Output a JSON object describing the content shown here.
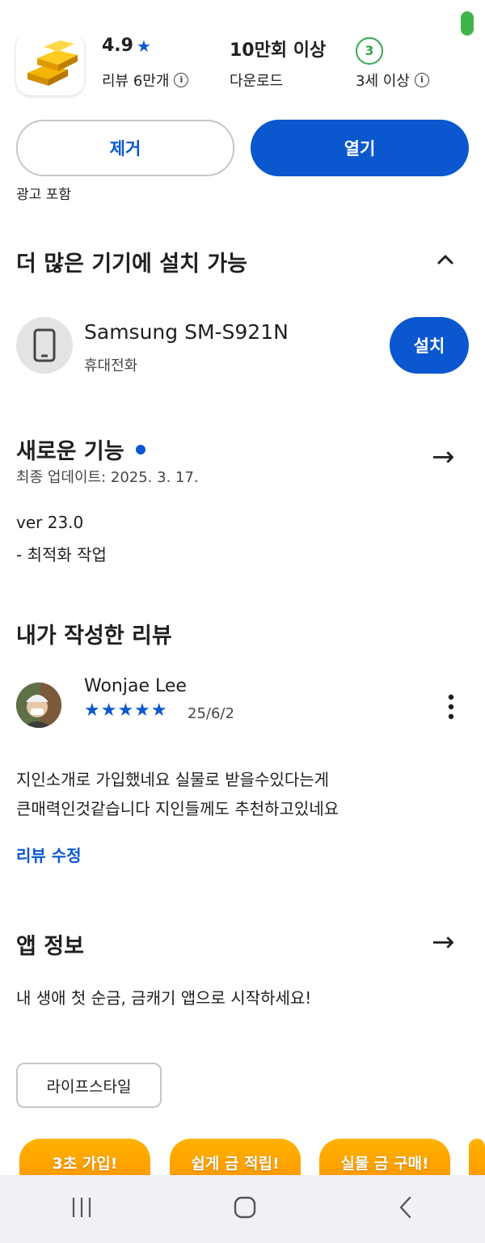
{
  "header": {
    "rating": "4.9",
    "reviews_label": "리뷰 6만개",
    "downloads_value": "10만회 이상",
    "downloads_label": "다운로드",
    "age_badge": "3",
    "age_label": "3세 이상"
  },
  "actions": {
    "uninstall_label": "제거",
    "open_label": "열기",
    "ads_note": "광고 포함"
  },
  "devices": {
    "title": "더 많은 기기에 설치 가능",
    "device_name": "Samsung SM-S921N",
    "device_type": "휴대전화",
    "install_label": "설치"
  },
  "whats_new": {
    "title": "새로운 기능",
    "updated": "최종 업데이트: 2025. 3. 17.",
    "version": "ver 23.0",
    "note": "- 최적화 작업"
  },
  "my_review": {
    "title": "내가 작성한 리뷰",
    "author": "Wonjae Lee",
    "stars": "★★★★★",
    "rating": 5,
    "date": "25/6/2",
    "line1": "지인소개로 가입했네요 실물로 받을수있다는게",
    "line2": "큰매력인것같습니다 지인들께도 추천하고있네요",
    "edit_label": "리뷰 수정"
  },
  "app_info": {
    "title": "앱 정보",
    "description": "내 생애 첫 순금, 금캐기 앱으로 시작하세요!",
    "category_chip": "라이프스타일"
  },
  "promos": [
    "3초 가입!",
    "쉽게 금 적립!",
    "실물 금 구매!"
  ],
  "colors": {
    "accent": "#0b57d0",
    "age_green": "#34a853",
    "promo_orange": "#ff9500"
  }
}
